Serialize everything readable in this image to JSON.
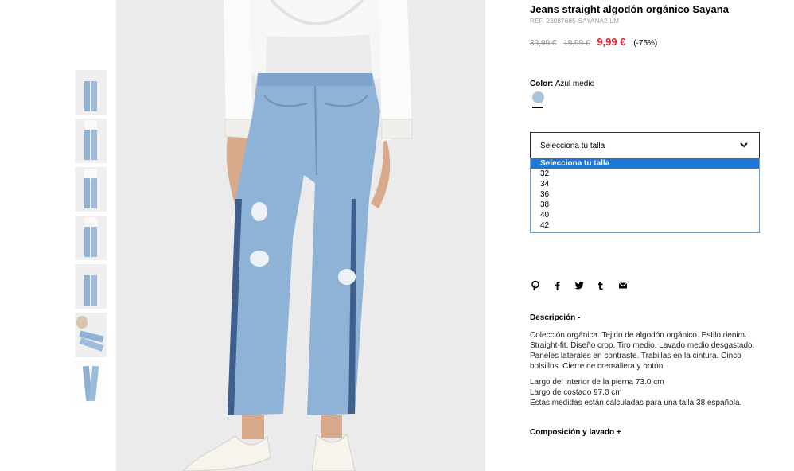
{
  "product": {
    "title": "Jeans straight algodón orgánico Sayana",
    "ref": "REF. 23087685-SAYANA2-LM",
    "price_original": "39,99 €",
    "price_previous": "19,99 €",
    "price_current": "9,99 €",
    "discount": "(-75%)",
    "color_label": "Color:",
    "color_value": "Azul medio",
    "colors": {
      "swatch": "#a9c3d8",
      "price": "#e4202e",
      "selected_option": "#1e78d7"
    }
  },
  "size_select": {
    "placeholder": "Selecciona tu talla",
    "options": [
      "Selecciona tu talla",
      "32",
      "34",
      "36",
      "38",
      "40",
      "42"
    ],
    "selected": "Selecciona tu talla"
  },
  "share_icons": [
    "pinterest-icon",
    "facebook-icon",
    "twitter-icon",
    "tumblr-icon",
    "mail-icon"
  ],
  "description": {
    "heading": "Descripción -",
    "text": "Colección orgánica. Tejido de algodón orgánico. Estilo denim. Straight-fit. Diseño crop. Tiro medio. Lavado medio desgastado. Paneles laterales en contraste. Trabillas en la cintura. Cinco bolsillos. Cierre de cremallera y botón.",
    "measurements": [
      "Largo del interior de la pierna 73.0 cm",
      "Largo de costado 97.0 cm",
      "Estas medidas están calculadas para una talla 38 española."
    ]
  },
  "composition": {
    "heading": "Composición y lavado +"
  },
  "thumbnails": [
    "jeans front",
    "model full",
    "model full back",
    "jeans detail",
    "jeans side",
    "model seated",
    "jeans flat"
  ]
}
